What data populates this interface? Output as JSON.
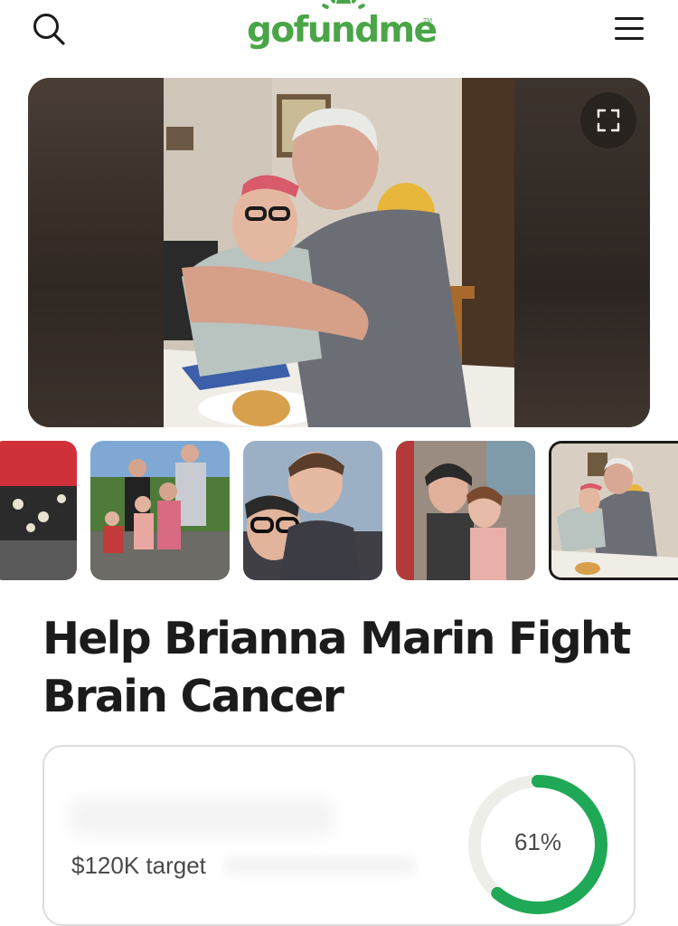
{
  "header": {
    "logo_text": "gofundme",
    "logo_tm": "TM",
    "search_icon": "search-icon",
    "menu_icon": "hamburger-menu-icon"
  },
  "hero": {
    "expand_icon": "fullscreen-expand-icon",
    "thumbnail_count": 5,
    "selected_thumbnail": 5
  },
  "campaign": {
    "title": "Help Brianna Marin Fight Brain Cancer",
    "target_text": "$120K target",
    "progress_percent_text": "61%",
    "progress_fraction": 0.61
  },
  "colors": {
    "brand_green": "#4aa548",
    "progress_green": "#1fa855",
    "progress_track": "#eeeee9",
    "text_dark": "#1b1b1b"
  }
}
